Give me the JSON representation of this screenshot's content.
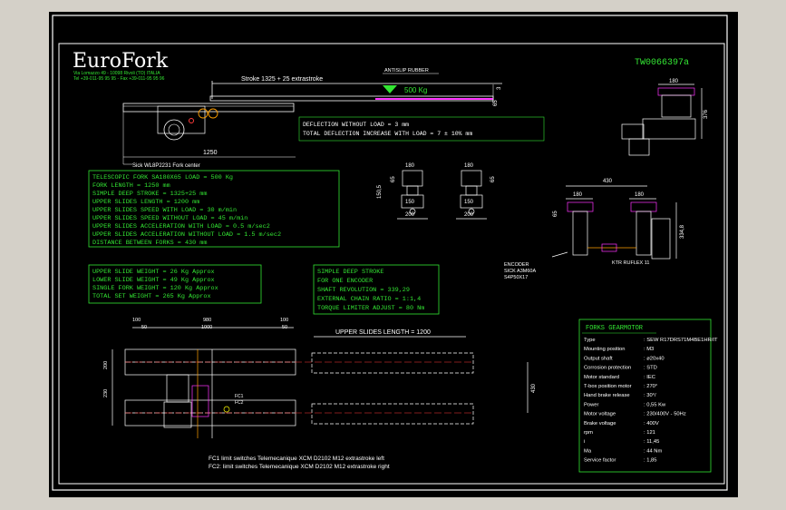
{
  "company": {
    "logo": "EuroFork",
    "address_line1": "Via Lomazzo 49 - 10098 Rivoli (TO) ITALIA",
    "address_line2": "Tel +39-011-95 95 95 - Fax +39-011-95 95 96"
  },
  "drawing_number": "TW0066397a",
  "side_view": {
    "stroke_label": "Stroke 1325 + 25 extrastroke",
    "antislip_label": "ANTISLIP RUBBER",
    "load_label": "500 Kg",
    "fork_length_dim": "1250",
    "dim_3": "3",
    "dim_65": "65",
    "deflection_line1": "DEFLECTION WITHOUT LOAD = 3 mm",
    "deflection_line2": "TOTAL DEFLECTION INCREASE WITH LOAD = 7 ± 10% mm",
    "sick_label": "Sick WL8P2231 Fork center"
  },
  "specs": [
    "TELESCOPIC FORK SA180X65   LOAD = 500 Kg",
    "FORK LENGTH = 1250 mm",
    "SIMPLE DEEP STROKE = 1325+25 mm",
    "UPPER SLIDES LENGTH = 1200 mm",
    "UPPER SLIDES SPEED WITH LOAD = 30 m/min",
    "UPPER SLIDES SPEED WITHOUT LOAD = 45 m/min",
    "UPPER SLIDES ACCELERATION WITH LOAD = 0.5 m/sec2",
    "UPPER SLIDES ACCELERATION WITHOUT LOAD = 1.5 m/sec2",
    "DISTANCE BETWEEN FORKS = 430 mm"
  ],
  "weights": [
    "UPPER SLIDE WEIGHT = 26 Kg Approx",
    "LOWER SLIDE WEIGHT = 49 Kg Approx",
    "SINGLE FORK WEIGHT = 120 Kg Approx",
    "TOTAL SET WEIGHT    = 265 Kg Approx"
  ],
  "encoder_box": [
    "SIMPLE DEEP STROKE",
    "FOR ONE ENCODER",
    "SHAFT REVOLUTION = 339,29",
    "EXTERNAL CHAIN RATIO = 1:1,4",
    "TORQUE LIMITER ADJUST = 80 Nm"
  ],
  "sections": {
    "dim_180a": "180",
    "dim_180b": "180",
    "dim_1505": "150,5",
    "dim_65a": "65",
    "dim_65b": "65",
    "dim_150a": "150",
    "dim_150b": "150",
    "dim_200a": "200",
    "dim_200b": "200"
  },
  "top_right": {
    "dim_180": "180",
    "dim_376": "376"
  },
  "front_view": {
    "dim_430": "430",
    "dim_180a": "180",
    "dim_180b": "180",
    "dim_65": "65",
    "dim_3348": "334,8",
    "encoder_label": "ENCODER",
    "encoder_model": "SICK A3M60A",
    "encoder_code": "S4P50X17",
    "ktr_label": "KTR RUFLEX 11"
  },
  "plan_view": {
    "upper_slides_label": "UPPER SLIDES LENGTH = 1200",
    "dim_100": "100",
    "dim_50a": "50",
    "dim_980": "980",
    "dim_1000": "1000",
    "dim_50b": "50",
    "dim_100b": "100",
    "dim_430": "430",
    "dim_230": "230",
    "dim_200": "200",
    "fc1": "FC1",
    "fc2": "FC2"
  },
  "limit_notes": [
    "FC1  limit switches Telemecanique XCM  D2102 M12 extrastroke left",
    "FC2: limit switches Telemecanique XCM  D2102 M12 extrastroke right"
  ],
  "gearmotor": {
    "title": "FORKS GEARMOTOR",
    "rows": [
      [
        "Type",
        ": SEW R17DRS71M4BE1HR/IT"
      ],
      [
        "Mounting position",
        ": M3"
      ],
      [
        "Output shaft",
        ": ø20x40"
      ],
      [
        "Corrosion protection",
        ": STD"
      ],
      [
        "Motor standard",
        ": IEC"
      ],
      [
        "T-box position motor",
        ": 270°"
      ],
      [
        "Hand brake release",
        ": 30°/"
      ],
      [
        "Power",
        ": 0,55 Kw"
      ],
      [
        "Motor voltage",
        ": 230/400V - 50Hz"
      ],
      [
        "Brake voltage",
        ": 400V"
      ],
      [
        "rpm",
        ": 121"
      ],
      [
        "i",
        ": 11,45"
      ],
      [
        "Ma",
        ": 44 Nm"
      ],
      [
        "Service factor",
        ": 1,85"
      ]
    ]
  },
  "colors": {
    "background": "#000000",
    "lines": "#ffffff",
    "text_green": "#33e633",
    "dims_cyan": "#00e5e5",
    "magenta": "#ff33ff",
    "yellow": "#ffff00",
    "red": "#ff3b3b",
    "orange": "#ffa000",
    "frame_grey": "#d4d0c8"
  }
}
